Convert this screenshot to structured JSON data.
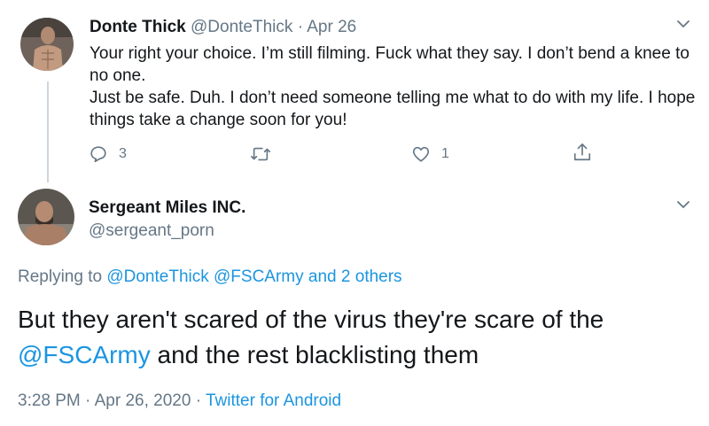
{
  "tweet1": {
    "display_name": "Donte Thick",
    "handle": "@DonteThick",
    "separator": "·",
    "date": "Apr 26",
    "text_lines": [
      "Your right your choice. I’m still filming. Fuck what they say. I don’t bend a knee to no one.",
      "Just be safe. Duh. I don’t need someone telling me what to do with my life. I hope things take a change soon for you!"
    ],
    "actions": {
      "reply_count": "3",
      "retweet_count": "",
      "like_count": "1"
    },
    "icons": [
      "chevron-down-icon",
      "reply-icon",
      "retweet-icon",
      "like-icon",
      "share-icon"
    ]
  },
  "tweet2": {
    "display_name": "Sergeant Miles INC.",
    "handle": "@sergeant_porn",
    "replying_prefix": "Replying to",
    "replying_to": [
      "@DonteThick",
      "@FSCArmy"
    ],
    "replying_others": "and 2 others",
    "text_part1": "But they aren't scared of the virus they're scare of the",
    "mention": "@FSCArmy",
    "text_part2": "and the rest blacklisting them",
    "time": "3:28 PM",
    "separator": "·",
    "full_date": "Apr 26, 2020",
    "source": "Twitter for Android"
  },
  "colors": {
    "text": "#14171a",
    "secondary": "#657786",
    "link": "#1b95e0",
    "thread_line": "#ccd6dd"
  }
}
